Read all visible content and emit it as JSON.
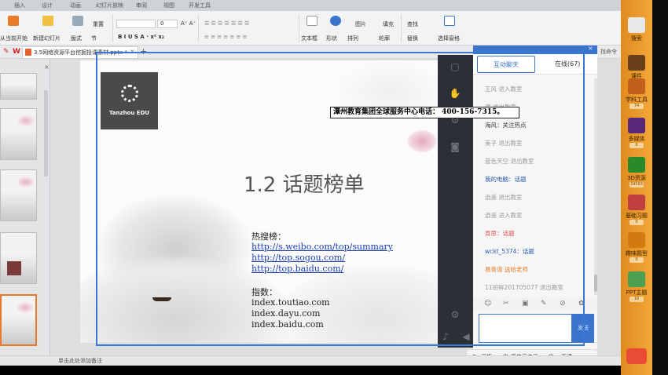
{
  "ribbon": {
    "tabs": [
      "插入",
      "设计",
      "动画",
      "幻灯片放映",
      "审阅",
      "视图",
      "开发工具"
    ],
    "buttons": {
      "from_current": "从当前开始",
      "new_slide": "新建幻灯片",
      "layout": "版式",
      "section": "节",
      "reset": "重置",
      "font_size": "0",
      "textbox": "文本框",
      "shape": "形状",
      "arrange": "排列",
      "outline": "轮廓",
      "picture": "图片",
      "fill": "填充",
      "find": "查找",
      "replace": "替换",
      "select_pane": "选择窗格"
    }
  },
  "tabbar": {
    "doc_name": "3.5网络资源平台挖掘投课素材.pptx *",
    "add": "+",
    "right_text": "找命令"
  },
  "slide": {
    "logo_text": "Tanzhou EDU",
    "title": "1.2 话题榜单",
    "hot_label": "热搜榜：",
    "links": [
      "http://s.weibo.com/top/summary",
      "http://top.sogou.com/",
      "http://top.baidu.com/"
    ],
    "index_label": "指数：",
    "indexes": [
      "index.toutiao.com",
      "index.dayu.com",
      "index.baidu.com"
    ]
  },
  "banner": "潭州教育集团全球服务中心电话：   400-156-7315。",
  "chat": {
    "tab_chat": "互动聊天",
    "tab_online": "在线(67)",
    "messages": [
      {
        "text": "王风 进入教室",
        "color": "#9a9a9a"
      },
      {
        "text": "渡 退出教室",
        "color": "#9a9a9a"
      },
      {
        "text": "海风：关注热点",
        "color": "#333333"
      },
      {
        "text": "美子 退出教室",
        "color": "#9a9a9a"
      },
      {
        "text": "蓝色天空 退出教室",
        "color": "#9a9a9a"
      },
      {
        "text": "我的电脑：话题",
        "color": "#2a5db0"
      },
      {
        "text": "逍遥 退出教室",
        "color": "#9a9a9a"
      },
      {
        "text": "逍遥 进入教室",
        "color": "#9a9a9a"
      },
      {
        "text": "肯思：话题",
        "color": "#d9534f"
      },
      {
        "text": "wckt_5374：话题",
        "color": "#2a5db0"
      },
      {
        "text": "易青道 送给老师",
        "color": "#e07b2a"
      },
      {
        "text": "11班鲜201705077 退出教室",
        "color": "#9a9a9a"
      }
    ],
    "send": "发送",
    "footer": {
      "board": "画板",
      "camera": "开启画中画",
      "exit": "下课"
    }
  },
  "right_toolbar": [
    {
      "label": "搜索",
      "count": ""
    },
    {
      "label": "课件",
      "count": "0"
    },
    {
      "label": "学科工具",
      "count": "74"
    },
    {
      "label": "多媒体",
      "count": "0"
    },
    {
      "label": "3D资源",
      "count": "39583"
    },
    {
      "label": "基础习题",
      "count": "0"
    },
    {
      "label": "趣味题型",
      "count": "0"
    },
    {
      "label": "PPT主题",
      "count": "16"
    }
  ],
  "status": {
    "notes_hint": "单击此处添加备注"
  },
  "colors": {
    "accent": "#3b74cc",
    "toolbar": "#f2a838",
    "dark": "#2b2f36"
  }
}
